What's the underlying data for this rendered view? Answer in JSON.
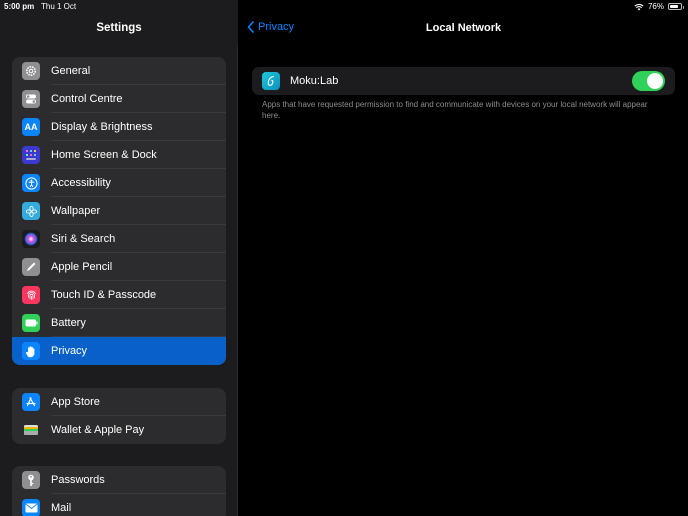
{
  "status_bar": {
    "time": "5:00 pm",
    "date": "Thu 1 Oct",
    "battery_percent": "76%",
    "battery_level": 0.76
  },
  "sidebar": {
    "title": "Settings",
    "group1": [
      {
        "label": "General",
        "icon": "gear-icon",
        "color": "#8e8e93"
      },
      {
        "label": "Control Centre",
        "icon": "toggles-icon",
        "color": "#8e8e93"
      },
      {
        "label": "Display & Brightness",
        "icon": "text-size-icon",
        "color": "#0a84ff"
      },
      {
        "label": "Home Screen & Dock",
        "icon": "grid-icon",
        "color": "#3a3ad1"
      },
      {
        "label": "Accessibility",
        "icon": "accessibility-icon",
        "color": "#0a84ff"
      },
      {
        "label": "Wallpaper",
        "icon": "flower-icon",
        "color": "#35aadc"
      },
      {
        "label": "Siri & Search",
        "icon": "siri-icon",
        "color": "#1c1c1e"
      },
      {
        "label": "Apple Pencil",
        "icon": "pencil-icon",
        "color": "#8e8e93"
      },
      {
        "label": "Touch ID & Passcode",
        "icon": "fingerprint-icon",
        "color": "#ff375f"
      },
      {
        "label": "Battery",
        "icon": "battery-icon",
        "color": "#30d158"
      },
      {
        "label": "Privacy",
        "icon": "hand-icon",
        "color": "#0a84ff",
        "selected": true
      }
    ],
    "group2": [
      {
        "label": "App Store",
        "icon": "app-store-icon",
        "color": "#0a84ff"
      },
      {
        "label": "Wallet & Apple Pay",
        "icon": "wallet-icon",
        "color": "#2c2c2e"
      }
    ],
    "group3": [
      {
        "label": "Passwords",
        "icon": "key-icon",
        "color": "#8e8e93"
      },
      {
        "label": "Mail",
        "icon": "mail-icon",
        "color": "#0a84ff"
      }
    ]
  },
  "detail": {
    "back_label": "Privacy",
    "title": "Local Network",
    "app": {
      "name": "Moku:Lab",
      "enabled": true
    },
    "footnote": "Apps that have requested permission to find and communicate with devices on your local network will appear here."
  }
}
